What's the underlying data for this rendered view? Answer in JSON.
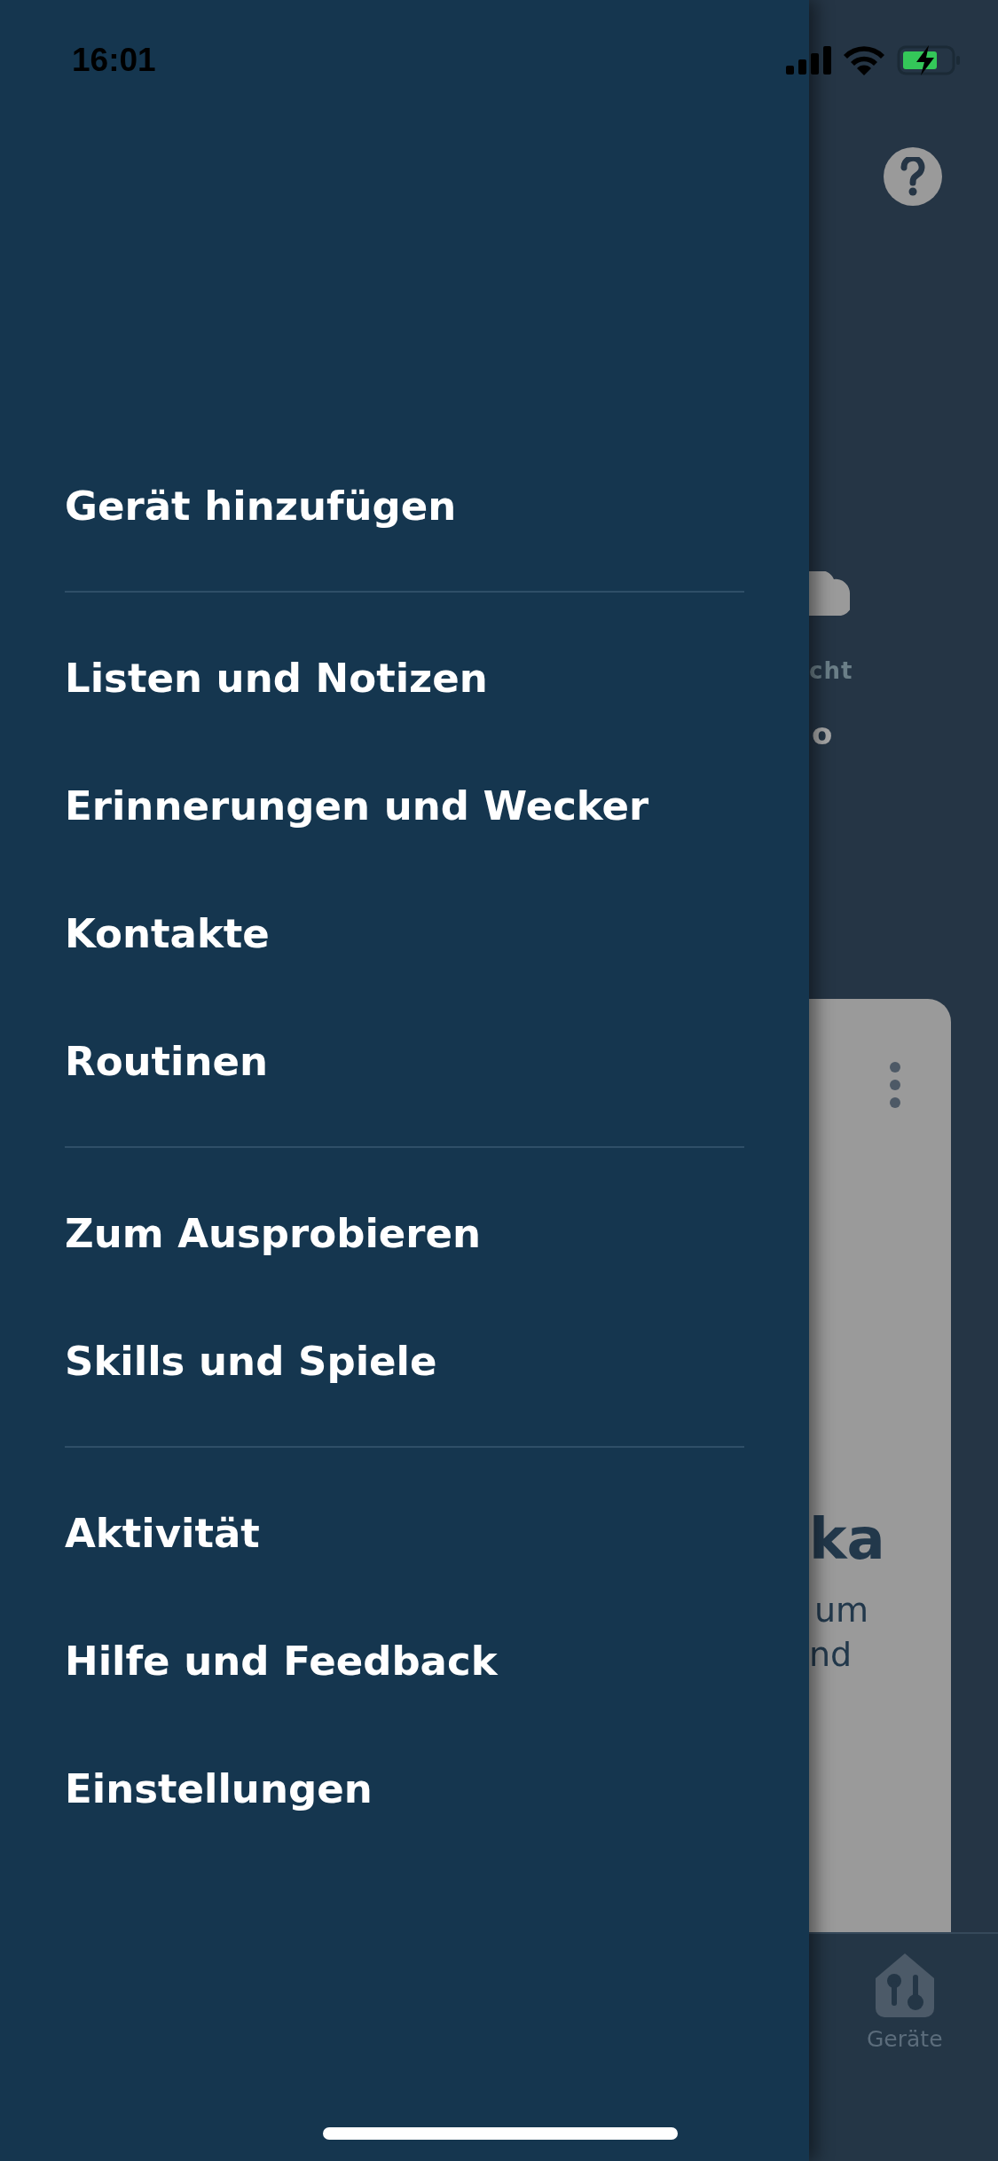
{
  "status_bar": {
    "time": "16:01"
  },
  "menu": {
    "sections": [
      [
        {
          "label": "Gerät hinzufügen"
        }
      ],
      [
        {
          "label": "Listen und Notizen"
        },
        {
          "label": "Erinnerungen und Wecker"
        },
        {
          "label": "Kontakte"
        },
        {
          "label": "Routinen"
        }
      ],
      [
        {
          "label": "Zum Ausprobieren"
        },
        {
          "label": "Skills und Spiele"
        }
      ],
      [
        {
          "label": "Aktivität"
        },
        {
          "label": "Hilfe und Feedback"
        },
        {
          "label": "Einstellungen"
        }
      ]
    ]
  },
  "background": {
    "weather_label": "cht",
    "weather_value": "o",
    "card": {
      "title": "ka",
      "body_lines": [
        "um",
        "nd"
      ]
    }
  },
  "tab_bar": {
    "label": "Geräte"
  }
}
